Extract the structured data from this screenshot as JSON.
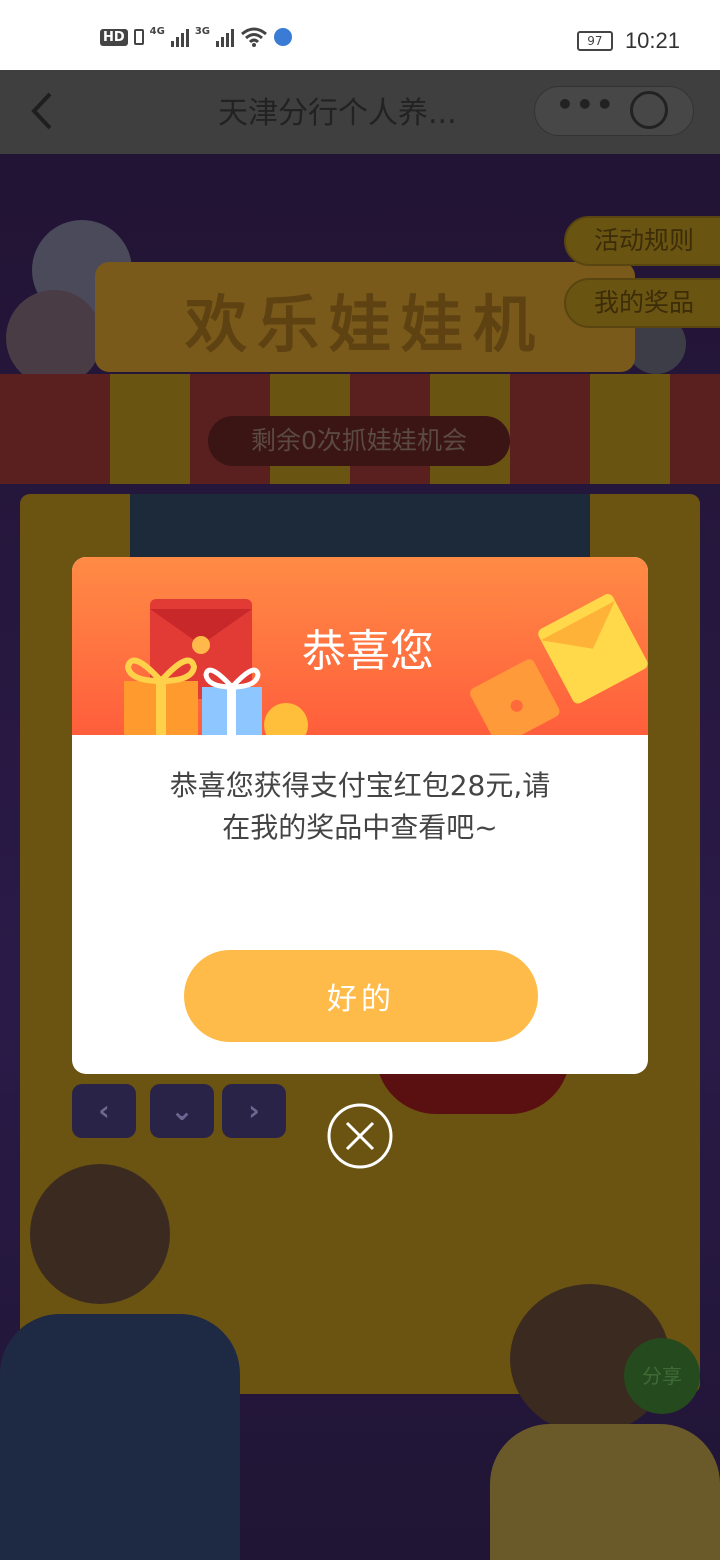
{
  "status_bar": {
    "hd_label": "HD",
    "network_1": "4G",
    "network_2": "3G",
    "battery_level": "97",
    "time": "10:21"
  },
  "nav": {
    "title": "天津分行个人养...",
    "more_label": "•••"
  },
  "background": {
    "game_title": "欢乐娃娃机",
    "remaining_text": "剩余0次抓娃娃机会",
    "rules_label": "活动规则",
    "my_prizes_label": "我的奖品",
    "share_label": "分享",
    "controls": [
      "left-arrow-icon",
      "down-arrow-icon",
      "right-arrow-icon"
    ]
  },
  "modal": {
    "title": "恭喜您",
    "message_line1": "恭喜您获得支付宝红包28元,请",
    "message_line2": "在我的奖品中查看吧~",
    "ok_label": "好的"
  },
  "colors": {
    "header_top": "#ff8b45",
    "header_bottom": "#ff5e3c",
    "ok_button": "#ffbb4a"
  }
}
